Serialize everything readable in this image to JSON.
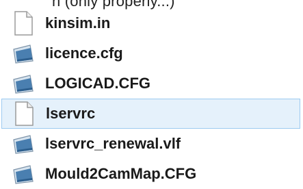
{
  "cut_line_text": "n (only properly...)",
  "files": [
    {
      "name": "kinsim.in",
      "icon": "blank-file-icon",
      "selected": false
    },
    {
      "name": "licence.cfg",
      "icon": "config-file-icon",
      "selected": false
    },
    {
      "name": "LOGICAD.CFG",
      "icon": "config-file-icon",
      "selected": false
    },
    {
      "name": "lservrc",
      "icon": "blank-file-icon",
      "selected": true
    },
    {
      "name": "lservrc_renewal.vlf",
      "icon": "config-file-icon",
      "selected": false
    },
    {
      "name": "Mould2CamMap.CFG",
      "icon": "config-file-icon",
      "selected": false
    }
  ],
  "colors": {
    "selection_background": "#e5f1fb",
    "selection_border": "#9ccaf1"
  }
}
